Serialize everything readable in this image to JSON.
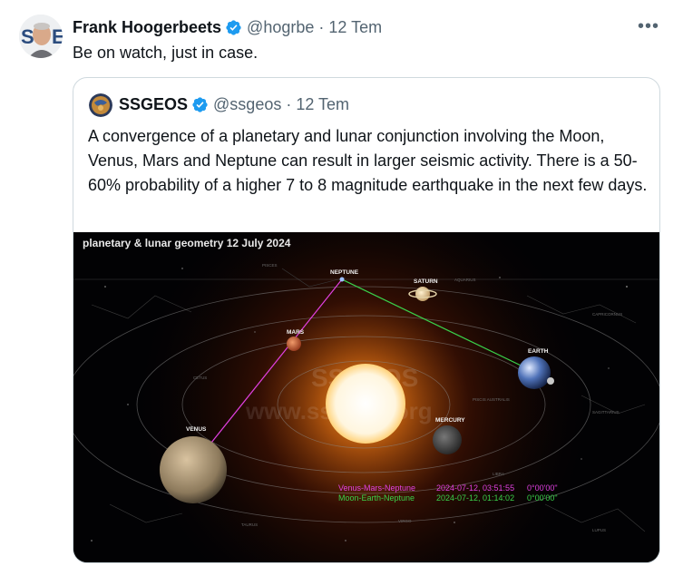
{
  "post": {
    "author_name": "Frank Hoogerbeets",
    "author_handle": "@hogrbe",
    "separator": "·",
    "timestamp": "12 Tem",
    "text": "Be on watch, just in case.",
    "more_label": "•••"
  },
  "quote": {
    "author_name": "SSGEOS",
    "author_handle": "@ssgeos",
    "separator": "·",
    "timestamp": "12 Tem",
    "text": "A convergence of a planetary and lunar conjunction involving the Moon, Venus, Mars and Neptune can result in larger seismic activity. There is a 50-60% probability of a higher 7 to 8 magnitude earthquake in the next few days."
  },
  "image": {
    "title": "planetary & lunar geometry 12 July 2024",
    "planets": {
      "neptune": "NEPTUNE",
      "saturn": "SATURN",
      "mars": "MARS",
      "earth": "EARTH",
      "venus": "VENUS",
      "mercury": "MERCURY"
    },
    "watermark": "SSGEOS",
    "watermark_url": "www.ssgeos.org",
    "legend": [
      {
        "name": "Venus-Mars-Neptune",
        "date": "2024-07-12, 03:51:55",
        "angle": "0°00'00\"",
        "color": "#e040e0"
      },
      {
        "name": "Moon-Earth-Neptune",
        "date": "2024-07-12, 01:14:02",
        "angle": "0°00'00\"",
        "color": "#3ad04a"
      }
    ],
    "constellations": [
      "PISCES",
      "AQUARIUS",
      "CAPRICORNUS",
      "SAGITTARIUS",
      "OPHIUCHUS",
      "LIBRA",
      "VIRGO",
      "LEO",
      "CANCER",
      "GEMINI",
      "TAURUS",
      "ARIES",
      "CETUS",
      "PISCIS AUSTRALIS",
      "LUPUS",
      "CRATER"
    ]
  },
  "colors": {
    "verified": "#1d9bf0",
    "muted": "#536471",
    "venus_mars_neptune_line": "#e040e0",
    "moon_earth_neptune_line": "#3ad04a"
  }
}
